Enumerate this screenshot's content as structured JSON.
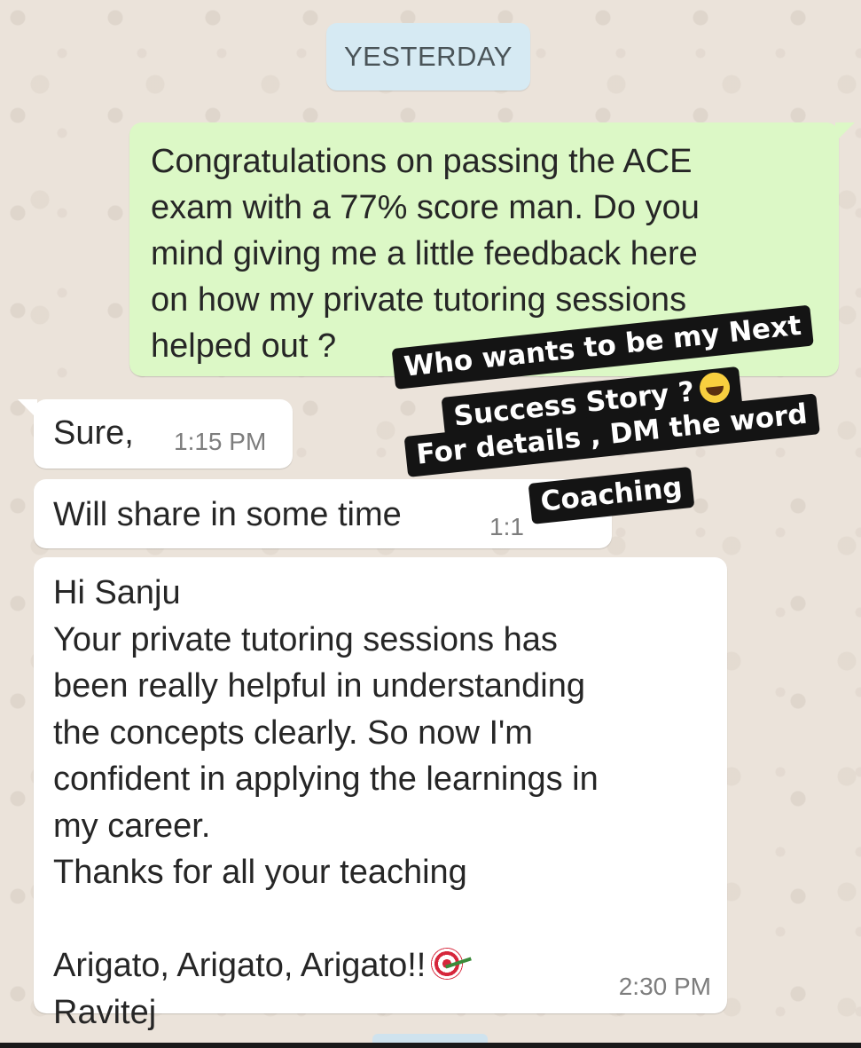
{
  "chat": {
    "date_label": "YESTERDAY",
    "messages": [
      {
        "direction": "outgoing",
        "text": "Congratulations on passing the ACE\nexam with a 77% score man. Do you\nmind giving me a little feedback here\non how my private tutoring sessions\nhelped out ?"
      },
      {
        "direction": "incoming",
        "text": "Sure,",
        "time": "1:15 PM"
      },
      {
        "direction": "incoming",
        "text": "Will share in some time",
        "time": "1:1"
      },
      {
        "direction": "incoming",
        "text": "Hi Sanju\nYour private tutoring sessions has\nbeen really helpful in understanding\nthe concepts clearly. So now I'm\nconfident in applying the learnings in\nmy career.\nThanks for all your teaching",
        "line_emoji_text": "Arigato, Arigato, Arigato!!",
        "emoji": "direct-hit-target",
        "signature": "Ravitej",
        "time": "2:30 PM"
      }
    ]
  },
  "overlay": {
    "line1": "Who wants to be my Next",
    "line2": "Success Story ?",
    "line2_emoji": "grinning-sweat",
    "line3": "For details , DM the word",
    "line4": "Coaching"
  },
  "colors": {
    "outgoing_bubble": "#dcf8c6",
    "incoming_bubble": "#ffffff",
    "date_chip": "#d6eaf3",
    "wallpaper": "#ebe3da",
    "sticker_bg": "#141414"
  }
}
